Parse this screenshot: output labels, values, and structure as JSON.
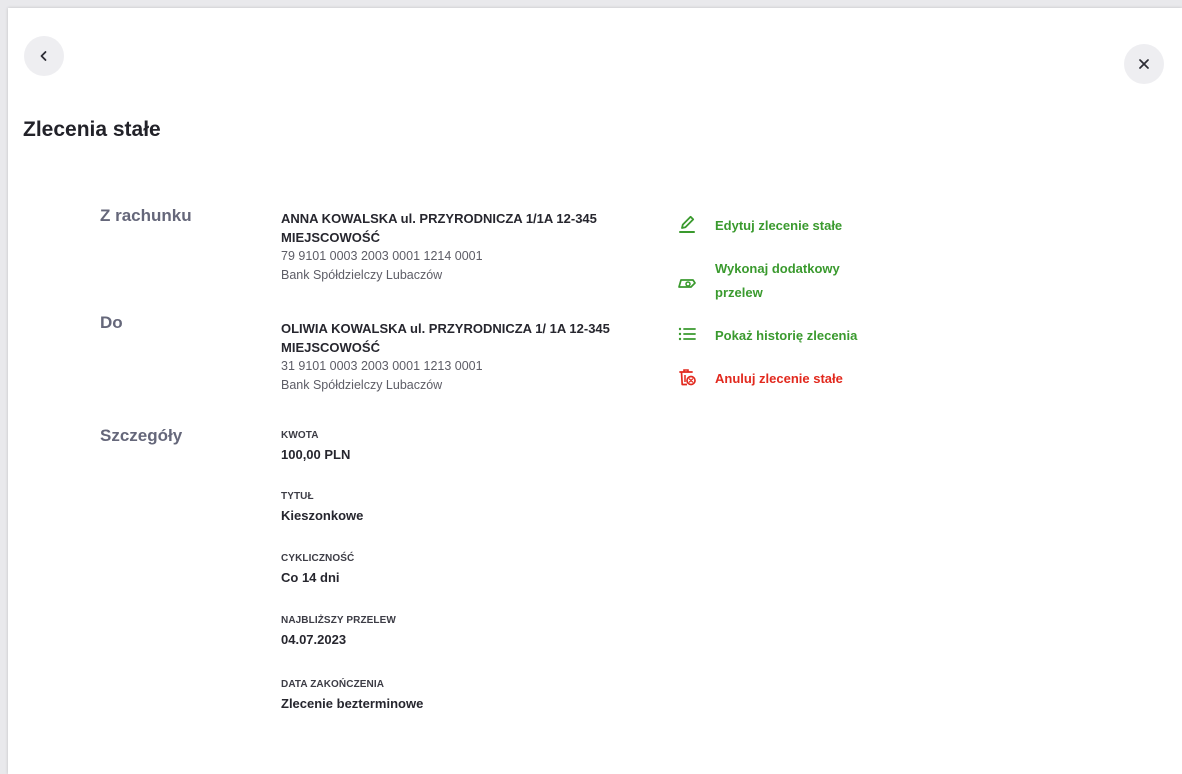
{
  "header": {
    "back_icon": "chevron-left-icon",
    "close_icon": "close-icon",
    "title": "Zlecenia stałe"
  },
  "sections": {
    "from": {
      "label": "Z rachunku",
      "name": "ANNA KOWALSKA ul. PRZYRODNICZA 1/1A 12-345 MIEJSCOWOŚĆ",
      "account": "79 9101 0003 2003 0001 1214 0001",
      "bank": "Bank Spółdzielczy Lubaczów"
    },
    "to": {
      "label": "Do",
      "name": "OLIWIA KOWALSKA ul. PRZYRODNICZA 1/ 1A 12-345 MIEJSCOWOŚĆ",
      "account": "31 9101 0003 2003 0001 1213 0001",
      "bank": "Bank Spółdzielczy Lubaczów"
    },
    "details": {
      "label": "Szczegóły",
      "items": [
        {
          "label": "KWOTA",
          "value": "100,00 PLN"
        },
        {
          "label": "TYTUŁ",
          "value": "Kieszonkowe"
        },
        {
          "label": "CYKLICZNOŚĆ",
          "value": "Co 14 dni"
        },
        {
          "label": "NAJBLIŻSZY PRZELEW",
          "value": "04.07.2023"
        },
        {
          "label": "DATA ZAKOŃCZENIA",
          "value": "Zlecenie bezterminowe"
        }
      ]
    }
  },
  "actions": [
    {
      "label": "Edytuj zlecenie stałe",
      "icon": "pencil-icon"
    },
    {
      "label": "Wykonaj dodatkowy przelew",
      "icon": "money-transfer-icon"
    },
    {
      "label": "Pokaż historię zlecenia",
      "icon": "list-icon"
    },
    {
      "label": "Anuluj zlecenie stałe",
      "icon": "trash-cancel-icon"
    }
  ],
  "colors": {
    "accent_green": "#3a9a2e",
    "danger_red": "#e2291e",
    "section_label": "#65677a"
  }
}
